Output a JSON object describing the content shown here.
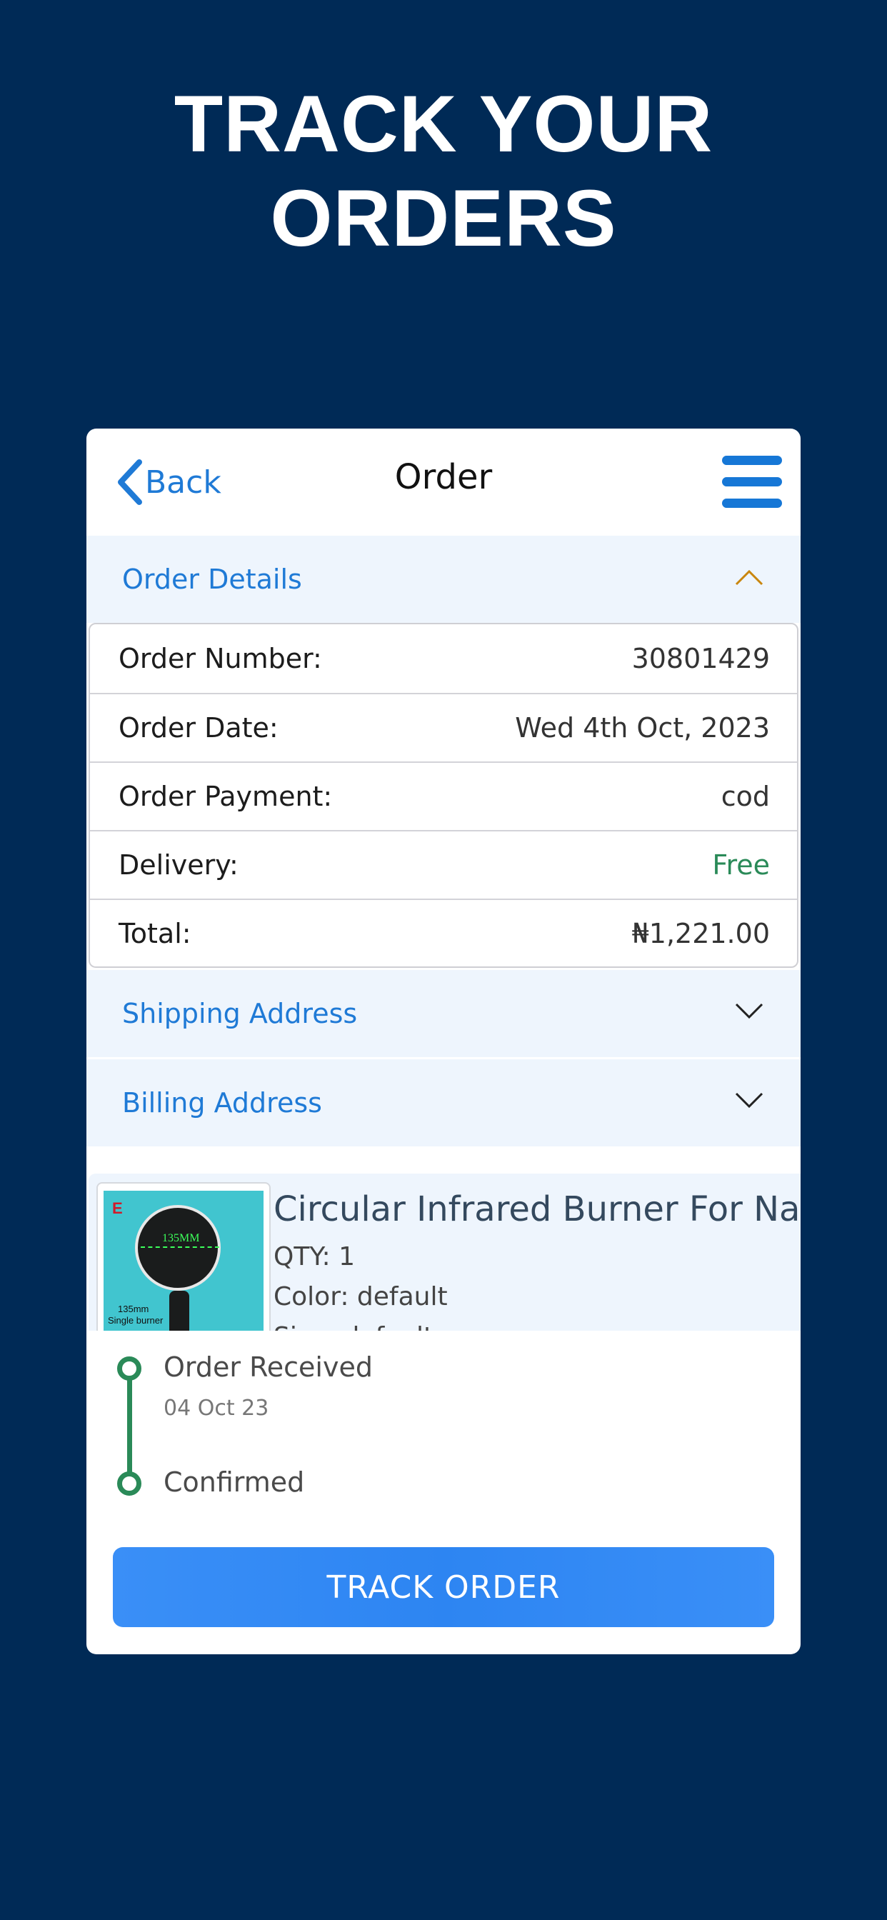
{
  "promo": {
    "headline_line1": "TRACK YOUR",
    "headline_line2": "ORDERS"
  },
  "topbar": {
    "back_label": "Back",
    "title": "Order",
    "menu_icon": "hamburger-menu-icon"
  },
  "order_details": {
    "header": "Order Details",
    "expanded": true,
    "rows": [
      {
        "label": "Order Number:",
        "value": "30801429"
      },
      {
        "label": "Order Date:",
        "value": "Wed 4th Oct, 2023"
      },
      {
        "label": "Order Payment:",
        "value": "cod"
      },
      {
        "label": "Delivery:",
        "value": "Free"
      },
      {
        "label": "Total:",
        "value": "₦1,221.00"
      }
    ]
  },
  "shipping_address": {
    "header": "Shipping Address",
    "expanded": false
  },
  "billing_address": {
    "header": "Billing Address",
    "expanded": false
  },
  "product": {
    "name": "Circular Infrared Burner For Na...",
    "qty": "QTY: 1",
    "color": "Color: default",
    "size": "Size: default",
    "image_text": {
      "letter": "E",
      "size": "135MM",
      "caption1": "135mm",
      "caption2": "Single burner"
    }
  },
  "timeline": [
    {
      "label": "Order Received",
      "date": "04 Oct 23"
    },
    {
      "label": "Confirmed"
    }
  ],
  "track_button_label": "TRACK ORDER",
  "colors": {
    "page_bg": "#002a56",
    "accent_blue": "#1f7ad6",
    "section_bg": "#eef5fd",
    "success_green": "#2a8a58",
    "button_blue": "#2d85f2",
    "chevron_up": "#c9860e"
  }
}
